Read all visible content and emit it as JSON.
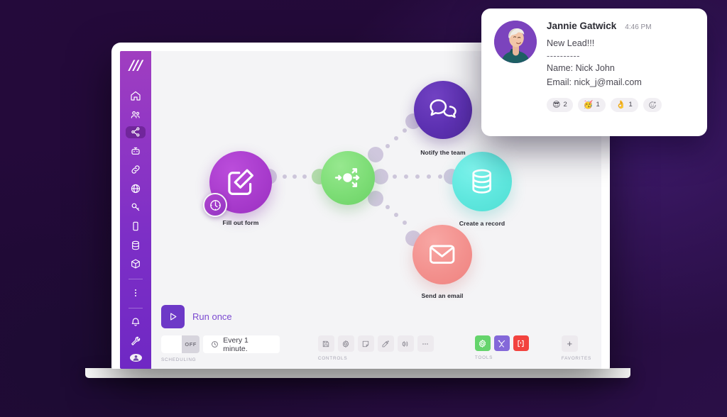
{
  "background": {
    "dark": "#240a3b",
    "light": "#3e1a6b"
  },
  "app": {
    "logo": "///",
    "sidebar": {
      "items": [
        {
          "name": "home",
          "icon": "home-icon",
          "active": false
        },
        {
          "name": "team",
          "icon": "people-icon",
          "active": false
        },
        {
          "name": "scenarios",
          "icon": "share-nodes-icon",
          "active": true
        },
        {
          "name": "templates",
          "icon": "robot-icon",
          "active": false
        },
        {
          "name": "connections",
          "icon": "link-icon",
          "active": false
        },
        {
          "name": "webhooks",
          "icon": "globe-icon",
          "active": false
        },
        {
          "name": "keys",
          "icon": "key-icon",
          "active": false
        },
        {
          "name": "devices",
          "icon": "phone-icon",
          "active": false
        },
        {
          "name": "data-stores",
          "icon": "database-icon",
          "active": false
        },
        {
          "name": "data-structures",
          "icon": "box-icon",
          "active": false
        },
        {
          "name": "more",
          "icon": "dots-vertical-icon",
          "active": false
        },
        {
          "name": "notifications",
          "icon": "bell-icon",
          "active": false
        },
        {
          "name": "tools",
          "icon": "wrench-icon",
          "active": false
        },
        {
          "name": "profile",
          "icon": "avatar-icon",
          "active": false
        }
      ]
    },
    "flow": {
      "nodes": [
        {
          "id": "fill-out-form",
          "label": "Fill out form",
          "icon": "edit-square-icon",
          "color": "#ae3fd0",
          "badge": "clock-icon"
        },
        {
          "id": "router",
          "label": "",
          "icon": "router-split-icon",
          "color": "#76da70"
        },
        {
          "id": "notify-the-team",
          "label": "Notify the team",
          "icon": "speech-bubbles-icon",
          "color": "#5e31b0"
        },
        {
          "id": "create-a-record",
          "label": "Create a record",
          "icon": "database-stack-icon",
          "color": "#63e8dd"
        },
        {
          "id": "send-an-email",
          "label": "Send an email",
          "icon": "envelope-icon",
          "color": "#f4918f"
        }
      ]
    },
    "bottom_bar": {
      "run_label": "Run once",
      "run_icon": "play-icon",
      "scheduling": {
        "group_label": "SCHEDULING",
        "toggle_state": "OFF",
        "interval_text": "Every 1 minute.",
        "interval_icon": "clock-icon"
      },
      "controls": {
        "group_label": "CONTROLS",
        "buttons": [
          {
            "name": "save",
            "icon": "save-disk-icon"
          },
          {
            "name": "settings",
            "icon": "gear-icon"
          },
          {
            "name": "notes",
            "icon": "note-icon"
          },
          {
            "name": "auto-align",
            "icon": "magic-wand-icon"
          },
          {
            "name": "explain-flow",
            "icon": "flow-icon"
          },
          {
            "name": "more-options",
            "icon": "ellipsis-icon"
          }
        ]
      },
      "tools": {
        "group_label": "TOOLS",
        "buttons": [
          {
            "name": "tools-gear",
            "icon": "gear-icon",
            "color": "#65d46c"
          },
          {
            "name": "tools-wrench",
            "icon": "tools-icon",
            "color": "#8468d9"
          },
          {
            "name": "tools-brackets",
            "icon": "brackets-icon",
            "color": "#f2433f"
          }
        ]
      },
      "favorites": {
        "group_label": "FAVORITES",
        "add_label": "+"
      }
    }
  },
  "chat": {
    "avatar_alt": "avatar",
    "author": "Jannie Gatwick",
    "time": "4:46 PM",
    "message_lines": [
      "New Lead!!!",
      "----------",
      "Name: Nick John",
      "Email: nick_j@mail.com"
    ],
    "reactions": [
      {
        "emoji": "😎",
        "count": "2"
      },
      {
        "emoji": "🥳",
        "count": "1"
      },
      {
        "emoji": "👌",
        "count": "1"
      }
    ],
    "add_reaction_icon": "add-reaction-icon"
  }
}
